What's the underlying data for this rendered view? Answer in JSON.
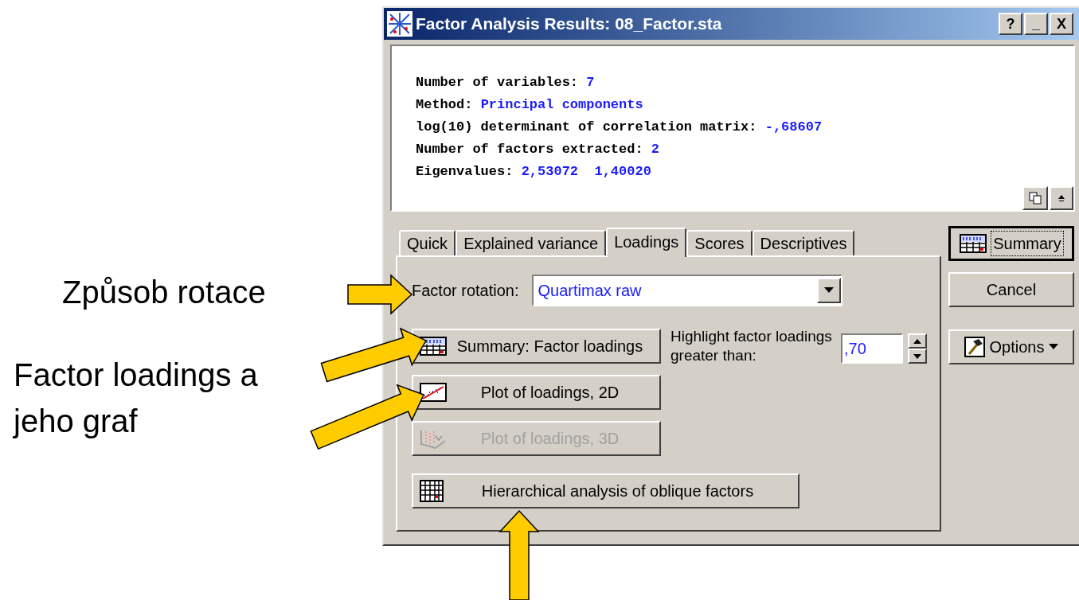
{
  "window": {
    "title": "Factor Analysis Results: 08_Factor.sta",
    "controls": [
      "?",
      "_",
      "X"
    ]
  },
  "output": {
    "lines": [
      {
        "label": "Number of variables:",
        "values": [
          "7"
        ]
      },
      {
        "label": "Method:",
        "values": [
          "Principal components"
        ]
      },
      {
        "label": "log(10) determinant of correlation matrix:",
        "values": [
          "-,68607"
        ]
      },
      {
        "label": "Number of factors extracted:",
        "values": [
          "2"
        ]
      },
      {
        "label": "Eigenvalues:",
        "values": [
          "2,53072",
          "1,40020"
        ]
      }
    ]
  },
  "tabs": [
    {
      "label": "Quick",
      "selected": false
    },
    {
      "label": "Explained variance",
      "selected": false
    },
    {
      "label": "Loadings",
      "selected": true
    },
    {
      "label": "Scores",
      "selected": false
    },
    {
      "label": "Descriptives",
      "selected": false
    }
  ],
  "factor_rotation": {
    "label": "Factor rotation:",
    "value": "Quartimax raw"
  },
  "buttons": [
    {
      "label": "Summary: Factor loadings",
      "kind": "table",
      "disabled": false
    },
    {
      "label": "Plot of loadings, 2D",
      "kind": "plot2d",
      "disabled": false
    },
    {
      "label": "Plot of loadings, 3D",
      "kind": "plot3d",
      "disabled": true
    },
    {
      "label": "Hierarchical analysis of oblique factors",
      "kind": "grid",
      "disabled": false
    }
  ],
  "highlight": {
    "label": "Highlight factor loadings greater than:",
    "value": ",70"
  },
  "side_buttons": [
    {
      "label": "Summary",
      "kind": "table",
      "default": true
    },
    {
      "label": "Cancel",
      "kind": "plain",
      "default": false
    },
    {
      "label": "Options",
      "kind": "options",
      "default": false
    }
  ],
  "annotations": [
    {
      "text": "Způsob rotace"
    },
    {
      "text": "Factor loadings a jeho graf"
    }
  ]
}
